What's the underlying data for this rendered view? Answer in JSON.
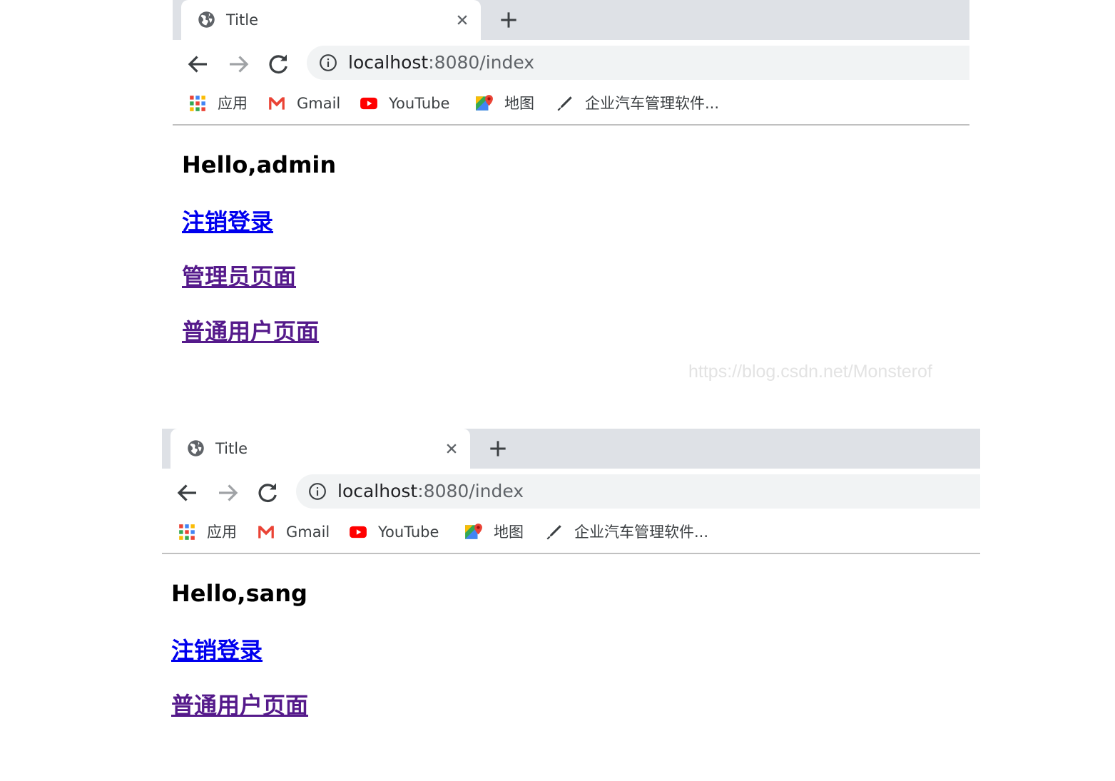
{
  "watermark": "https://blog.csdn.net/Monsterof",
  "windows": [
    {
      "tab": {
        "title": "Title",
        "favicon": "globe-icon",
        "close": "close-icon",
        "new_tab": "plus-icon"
      },
      "address_bar": {
        "host": "localhost",
        "path": ":8080/index"
      },
      "bookmarks": [
        {
          "label": "应用",
          "icon": "apps-grid-icon"
        },
        {
          "label": "Gmail",
          "icon": "gmail-icon"
        },
        {
          "label": "YouTube",
          "icon": "youtube-icon"
        },
        {
          "label": "地图",
          "icon": "maps-icon"
        },
        {
          "label": "企业汽车管理软件...",
          "icon": "pen-icon"
        }
      ],
      "content": {
        "greeting": "Hello,admin",
        "links": [
          "注销登录",
          "管理员页面",
          "普通用户页面"
        ]
      }
    },
    {
      "tab": {
        "title": "Title",
        "favicon": "globe-icon",
        "close": "close-icon",
        "new_tab": "plus-icon"
      },
      "address_bar": {
        "host": "localhost",
        "path": ":8080/index"
      },
      "bookmarks": [
        {
          "label": "应用",
          "icon": "apps-grid-icon"
        },
        {
          "label": "Gmail",
          "icon": "gmail-icon"
        },
        {
          "label": "YouTube",
          "icon": "youtube-icon"
        },
        {
          "label": "地图",
          "icon": "maps-icon"
        },
        {
          "label": "企业汽车管理软件...",
          "icon": "pen-icon"
        }
      ],
      "content": {
        "greeting": "Hello,sang",
        "links": [
          "注销登录",
          "普通用户页面"
        ]
      }
    }
  ],
  "colors": {
    "tabstrip": "#dee1e6",
    "omnibox": "#f1f3f4",
    "link_unvisited": "#0000ee",
    "link_visited": "#551a8b"
  }
}
